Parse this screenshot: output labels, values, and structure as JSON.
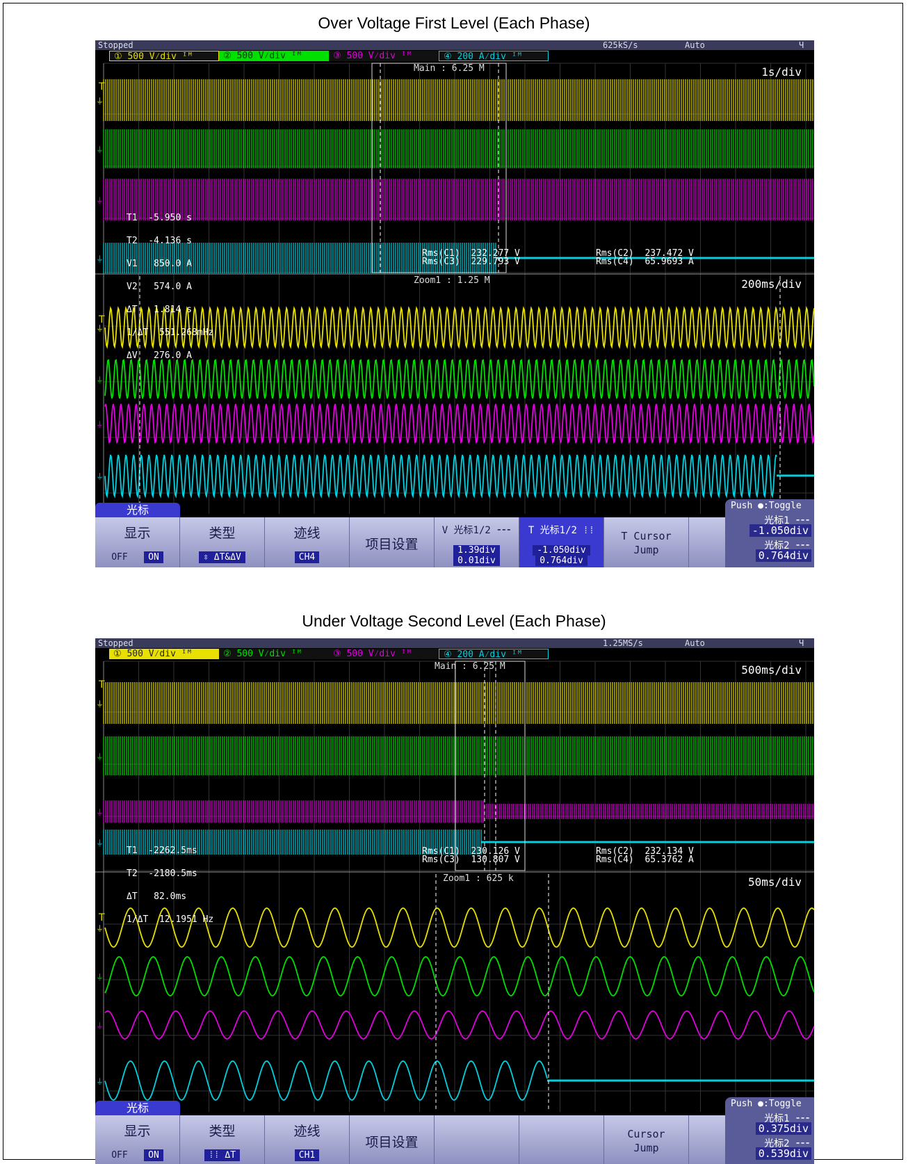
{
  "panel1": {
    "caption": "Over Voltage First Level (Each Phase)",
    "status": {
      "state": "Stopped",
      "rate": "625kS/s",
      "mode": "Auto",
      "flag": "Ч"
    },
    "channels": [
      {
        "label": "① 500 V⁄div ᴵᴹ",
        "color": "#e8e000"
      },
      {
        "label": "② 500 V⁄div ᴵᴹ",
        "color": "#00e000"
      },
      {
        "label": "③ 500 V⁄div ᴵᴹ",
        "color": "#e000e0"
      },
      {
        "label": "④ 200 A⁄div ᴵᴹ",
        "color": "#00d0e0"
      }
    ],
    "main_label": "Main : 6.25 M",
    "main_tdiv": "1s/div",
    "zoom_label": "Zoom1 : 1.25 M",
    "zoom_tdiv": "200ms/div",
    "readouts": [
      "T1  -5.950 s",
      "T2  -4.136 s",
      "V1   850.0 A",
      "V2   574.0 A",
      "ΔT   1.814 s",
      "1/ΔT  551.268mHz",
      "ΔV   276.0 A"
    ],
    "rms": {
      "c1": "Rms(C1)  232.277 V",
      "c3": "Rms(C3)  229.793 V",
      "c2": "Rms(C2)  237.472 V",
      "c4": "Rms(C4)  65.9693 A"
    },
    "menu": {
      "tab": "光标",
      "display": "显示",
      "off": "OFF",
      "on": "ON",
      "type": "类型",
      "type_val": "⇳ ΔT&ΔV",
      "trace": "迹线",
      "trace_val": "CH4",
      "setup": "项目设置",
      "vcursor": "V 光标1/2 ⁃⁃⁃",
      "v1": "1.39div",
      "v2": "0.01div",
      "tcursor": "T 光标1/2 ⁞⁞",
      "t1": "-1.050div",
      "t2": "0.764div",
      "jump1": "T Cursor",
      "jump2": "Jump",
      "push": "Push ●:Toggle",
      "c1lbl": "光标1 ⁃⁃⁃",
      "c1val": "-1.050div",
      "c2lbl": "光标2 ⁃⁃⁃",
      "c2val": "0.764div"
    }
  },
  "panel2": {
    "caption": "Under Voltage Second Level (Each Phase)",
    "status": {
      "state": "Stopped",
      "rate": "1.25MS/s",
      "mode": "Auto",
      "flag": "Ч"
    },
    "channels": [
      {
        "label": "① 500 V⁄div ᴵᴹ",
        "color": "#e8e000"
      },
      {
        "label": "② 500 V⁄div ᴵᴹ",
        "color": "#00e000"
      },
      {
        "label": "③ 500 V⁄div ᴵᴹ",
        "color": "#e000e0"
      },
      {
        "label": "④ 200 A⁄div ᴵᴹ",
        "color": "#00d0e0"
      }
    ],
    "main_label": "Main : 6.25 M",
    "main_tdiv": "500ms/div",
    "zoom_label": "Zoom1 : 625 k",
    "zoom_tdiv": "50ms/div",
    "readouts": [
      "T1  -2262.5ms",
      "T2  -2180.5ms",
      "ΔT   82.0ms",
      "1/ΔT  12.1951 Hz"
    ],
    "rms": {
      "c1": "Rms(C1)  230.126 V",
      "c3": "Rms(C3)  130.807 V",
      "c2": "Rms(C2)  232.134 V",
      "c4": "Rms(C4)  65.3762 A"
    },
    "menu": {
      "tab": "光标",
      "display": "显示",
      "off": "OFF",
      "on": "ON",
      "type": "类型",
      "type_val": "⁞⁞ ΔT",
      "trace": "迹线",
      "trace_val": "CH1",
      "setup": "项目设置",
      "jump1": "Cursor",
      "jump2": "Jump",
      "push": "Push ●:Toggle",
      "c1lbl": "光标1 ⁃⁃⁃",
      "c1val": "0.375div",
      "c2lbl": "光标2 ⁃⁃⁃",
      "c2val": "0.539div"
    }
  }
}
